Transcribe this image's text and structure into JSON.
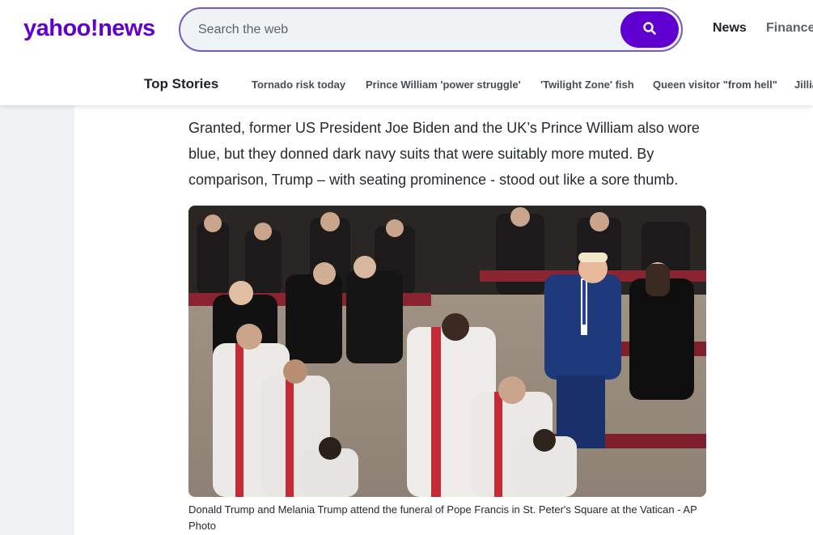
{
  "header": {
    "logo_yahoo": "yahoo!",
    "logo_news": "news",
    "search_placeholder": "Search the web",
    "nav": {
      "news": "News",
      "finance": "Finance"
    }
  },
  "substrip": {
    "top_stories": "Top Stories",
    "trending": [
      "Tornado risk today",
      "Prince William 'power struggle'",
      "'Twilight Zone' fish",
      "Queen visitor \"from hell\"",
      "Jillia"
    ]
  },
  "article": {
    "paragraph": "Granted, former US President Joe Biden and the UK’s Prince William also wore blue, but they donned dark navy suits that were suitably more muted. By comparison, Trump – with seating prominence - stood out like a sore thumb.",
    "caption": "Donald Trump and Melania Trump attend the funeral of Pope Francis in St. Peter's Square at the Vatican - AP Photo"
  },
  "colors": {
    "brand": "#6001d2",
    "rail": "#f0f3f5",
    "search_border": "#7759c2"
  }
}
